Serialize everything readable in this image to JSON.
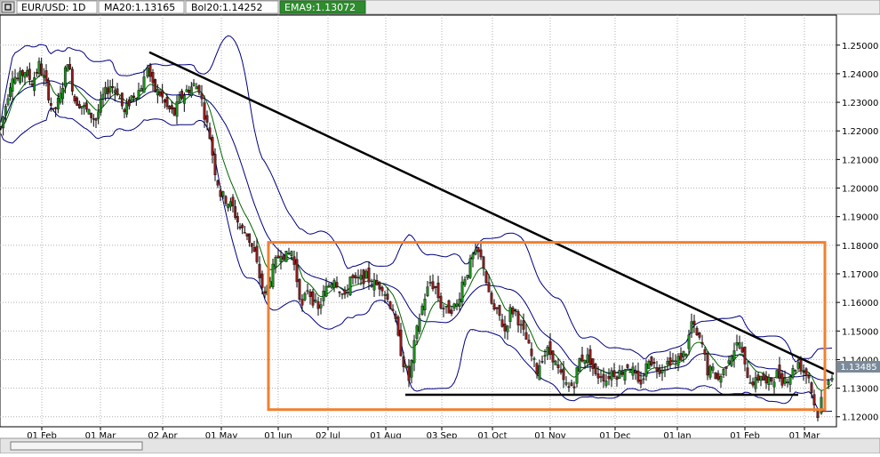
{
  "header": {
    "menu_icon": "window-menu-icon",
    "symbol_label": "EUR/USD: 1D",
    "ma_label": "MA20:1.13165",
    "bol_label": "Bol20:1.14252",
    "ema_label": "EMA9:1.13072",
    "ma_color": "#000080",
    "ema_color": "#006400"
  },
  "chart_data": {
    "type": "candlestick",
    "y_range": [
      1.1165,
      1.2605
    ],
    "y_ticks": [
      "1.25000",
      "1.24000",
      "1.23000",
      "1.22000",
      "1.21000",
      "1.20000",
      "1.19000",
      "1.18000",
      "1.17000",
      "1.16000",
      "1.15000",
      "1.14000",
      "1.13000",
      "1.12000"
    ],
    "x_labels": [
      "01 Feb",
      "01 Mar",
      "02 Apr",
      "01 May",
      "01 Jun",
      "02 Jul",
      "01 Aug",
      "03 Sep",
      "01 Oct",
      "01 Nov",
      "01 Dec",
      "01 Jan",
      "01 Feb",
      "01 Mar"
    ],
    "current_price": "1.13485",
    "close_path": [
      [
        1,
        1.221
      ],
      [
        9,
        1.233
      ],
      [
        14,
        1.24
      ],
      [
        20,
        1.238
      ],
      [
        28,
        1.241
      ],
      [
        36,
        1.237
      ],
      [
        44,
        1.243
      ],
      [
        52,
        1.236
      ],
      [
        60,
        1.226
      ],
      [
        68,
        1.232
      ],
      [
        76,
        1.245
      ],
      [
        84,
        1.231
      ],
      [
        92,
        1.229
      ],
      [
        100,
        1.226
      ],
      [
        108,
        1.224
      ],
      [
        116,
        1.232
      ],
      [
        124,
        1.236
      ],
      [
        132,
        1.234
      ],
      [
        140,
        1.226
      ],
      [
        148,
        1.232
      ],
      [
        156,
        1.234
      ],
      [
        162,
        1.238
      ],
      [
        166,
        1.243
      ],
      [
        172,
        1.235
      ],
      [
        180,
        1.233
      ],
      [
        188,
        1.228
      ],
      [
        196,
        1.226
      ],
      [
        202,
        1.231
      ],
      [
        210,
        1.234
      ],
      [
        218,
        1.236
      ],
      [
        224,
        1.235
      ],
      [
        230,
        1.226
      ],
      [
        236,
        1.218
      ],
      [
        242,
        1.206
      ],
      [
        248,
        1.198
      ],
      [
        254,
        1.196
      ],
      [
        262,
        1.193
      ],
      [
        270,
        1.186
      ],
      [
        278,
        1.184
      ],
      [
        286,
        1.177
      ],
      [
        292,
        1.169
      ],
      [
        298,
        1.162
      ],
      [
        304,
        1.169
      ],
      [
        310,
        1.174
      ],
      [
        316,
        1.178
      ],
      [
        322,
        1.176
      ],
      [
        328,
        1.178
      ],
      [
        334,
        1.168
      ],
      [
        340,
        1.158
      ],
      [
        346,
        1.165
      ],
      [
        352,
        1.161
      ],
      [
        358,
        1.157
      ],
      [
        364,
        1.163
      ],
      [
        370,
        1.166
      ],
      [
        376,
        1.169
      ],
      [
        382,
        1.165
      ],
      [
        388,
        1.161
      ],
      [
        394,
        1.169
      ],
      [
        400,
        1.167
      ],
      [
        406,
        1.168
      ],
      [
        412,
        1.169
      ],
      [
        418,
        1.167
      ],
      [
        424,
        1.166
      ],
      [
        430,
        1.166
      ],
      [
        436,
        1.161
      ],
      [
        442,
        1.158
      ],
      [
        448,
        1.147
      ],
      [
        454,
        1.139
      ],
      [
        460,
        1.133
      ],
      [
        466,
        1.145
      ],
      [
        472,
        1.155
      ],
      [
        478,
        1.162
      ],
      [
        484,
        1.167
      ],
      [
        490,
        1.165
      ],
      [
        496,
        1.159
      ],
      [
        502,
        1.157
      ],
      [
        508,
        1.158
      ],
      [
        514,
        1.159
      ],
      [
        520,
        1.167
      ],
      [
        526,
        1.171
      ],
      [
        532,
        1.176
      ],
      [
        538,
        1.177
      ],
      [
        544,
        1.173
      ],
      [
        550,
        1.162
      ],
      [
        556,
        1.157
      ],
      [
        562,
        1.155
      ],
      [
        568,
        1.15
      ],
      [
        574,
        1.157
      ],
      [
        580,
        1.157
      ],
      [
        586,
        1.151
      ],
      [
        592,
        1.147
      ],
      [
        598,
        1.141
      ],
      [
        604,
        1.136
      ],
      [
        610,
        1.141
      ],
      [
        616,
        1.143
      ],
      [
        622,
        1.141
      ],
      [
        628,
        1.136
      ],
      [
        634,
        1.132
      ],
      [
        640,
        1.13
      ],
      [
        646,
        1.132
      ],
      [
        652,
        1.14
      ],
      [
        658,
        1.141
      ],
      [
        664,
        1.14
      ],
      [
        670,
        1.134
      ],
      [
        676,
        1.135
      ],
      [
        682,
        1.133
      ],
      [
        688,
        1.136
      ],
      [
        694,
        1.135
      ],
      [
        700,
        1.136
      ],
      [
        706,
        1.138
      ],
      [
        712,
        1.136
      ],
      [
        718,
        1.131
      ],
      [
        724,
        1.134
      ],
      [
        730,
        1.141
      ],
      [
        736,
        1.138
      ],
      [
        742,
        1.137
      ],
      [
        748,
        1.138
      ],
      [
        754,
        1.14
      ],
      [
        760,
        1.139
      ],
      [
        766,
        1.141
      ],
      [
        772,
        1.143
      ],
      [
        778,
        1.153
      ],
      [
        784,
        1.148
      ],
      [
        790,
        1.145
      ],
      [
        796,
        1.136
      ],
      [
        802,
        1.136
      ],
      [
        808,
        1.133
      ],
      [
        814,
        1.136
      ],
      [
        820,
        1.141
      ],
      [
        826,
        1.144
      ],
      [
        832,
        1.146
      ],
      [
        838,
        1.137
      ],
      [
        844,
        1.133
      ],
      [
        850,
        1.132
      ],
      [
        856,
        1.135
      ],
      [
        862,
        1.131
      ],
      [
        868,
        1.133
      ],
      [
        874,
        1.135
      ],
      [
        880,
        1.133
      ],
      [
        886,
        1.134
      ],
      [
        892,
        1.136
      ],
      [
        898,
        1.139
      ],
      [
        904,
        1.136
      ],
      [
        910,
        1.134
      ],
      [
        916,
        1.124
      ],
      [
        920,
        1.121
      ],
      [
        924,
        1.126
      ],
      [
        928,
        1.131
      ],
      [
        932,
        1.134
      ],
      [
        936,
        1.135
      ]
    ],
    "drawings": {
      "trendline": {
        "start": [
          168,
          1.2475
        ],
        "end": [
          938,
          1.135
        ],
        "color": "#000000"
      },
      "support_line": {
        "start": [
          456,
          1.1277
        ],
        "end": [
          898,
          1.1277
        ],
        "color": "#000000"
      },
      "range_box": {
        "x_start": 302,
        "x_end": 928,
        "top": 1.181,
        "bottom": 1.1225,
        "color": "#f08030"
      }
    }
  }
}
